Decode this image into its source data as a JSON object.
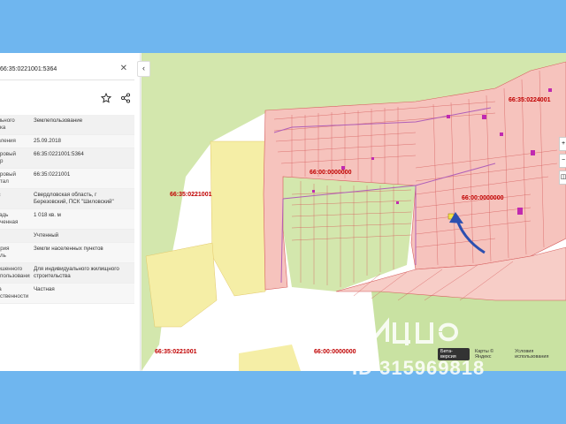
{
  "search": {
    "value": "66:35:0221001:5364"
  },
  "rows": [
    {
      "key": "Вид земельного участка",
      "value": "Землепользование"
    },
    {
      "key": "Дата постановки",
      "value": "25.09.2018"
    },
    {
      "key": "Кадастровый номер",
      "value": "66:35:0221001:5364"
    },
    {
      "key": "Кадастровый квартал",
      "value": "66:35:0221001"
    },
    {
      "key": "Адрес",
      "value": "Свердловская область, г Березовский, ПСК \"Шиловский\""
    },
    {
      "key": "Площадь уточненная",
      "value": "1 018 кв. м"
    },
    {
      "key": "Статус",
      "value": "Учтенный"
    },
    {
      "key": "Категория земель",
      "value": "Земли населенных пунктов"
    },
    {
      "key": "Разрешенное использование",
      "value": "Для индивидуального жилищного строительства"
    },
    {
      "key": "Форма собственности",
      "value": "Частная"
    }
  ],
  "rows_display": [
    {
      "key": "ального\nка",
      "value": "Землепользование"
    },
    {
      "key": "овления",
      "value": "25.09.2018"
    },
    {
      "key": "стровый\nр",
      "value": "66:35:0221001:5364"
    },
    {
      "key": "стровый\nтал",
      "value": "66:35:0221001"
    },
    {
      "key": "ес",
      "value": "Свердловская область, г Березовский, ПСК \"Шиловский\""
    },
    {
      "key": "щадь\nченная",
      "value": "1 018 кв. м"
    },
    {
      "key": "ус",
      "value": "Учтенный"
    },
    {
      "key": "тория\nль",
      "value": "Земли населенных пунктов"
    },
    {
      "key": "решенного\nпользования",
      "value": "Для индивидуального жилищного строительства"
    },
    {
      "key": "ма\nственности",
      "value": "Частная"
    }
  ],
  "map_labels": {
    "q1": "66:35:0221001",
    "q2": "66:00:0000000",
    "q3": "66:00:0000000",
    "q4": "66:35:0221001",
    "q5": "66:00:0000000",
    "q6": "66:35:0224001"
  },
  "footer": {
    "beta": "Бета-версия",
    "maps": "Карты © Яндекс",
    "terms": "Условия использования"
  },
  "watermark": "ID 315969818",
  "colors": {
    "background": "#6fb6ef",
    "parcel_fill": "#f6c2bc",
    "parcel_stroke": "#d55b5b",
    "green": "#d2e8a8",
    "yellow": "#f4eda6",
    "arrow": "#2d4fb0"
  },
  "icons": [
    "star-icon",
    "share-icon",
    "close-icon",
    "chevron-left-icon",
    "arrow-icon"
  ]
}
